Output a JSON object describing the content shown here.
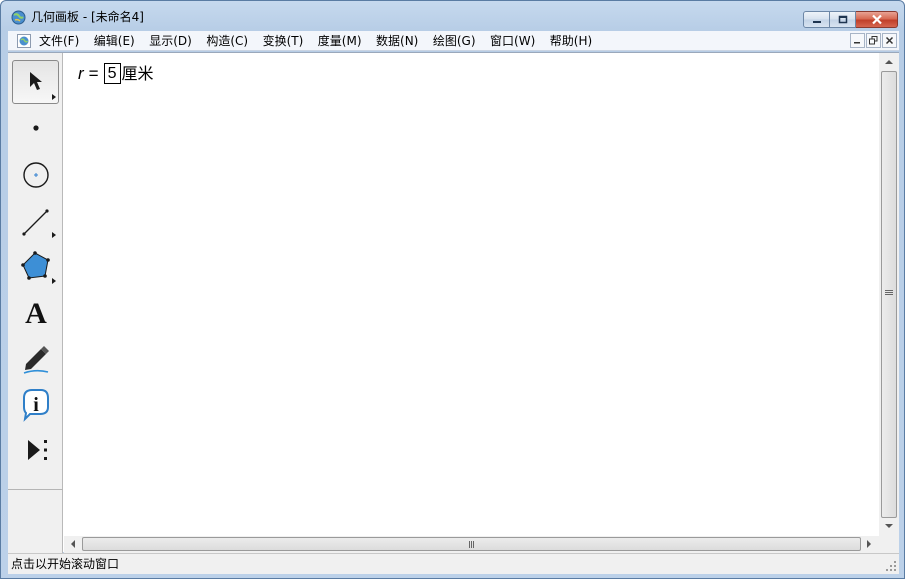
{
  "titlebar": {
    "title": "几何画板 - [未命名4]",
    "icons": [
      "app-globe-icon",
      "minimize-icon",
      "maximize-icon",
      "close-icon"
    ]
  },
  "menubar": {
    "items": [
      {
        "label": "文件(F)"
      },
      {
        "label": "编辑(E)"
      },
      {
        "label": "显示(D)"
      },
      {
        "label": "构造(C)"
      },
      {
        "label": "变换(T)"
      },
      {
        "label": "度量(M)"
      },
      {
        "label": "数据(N)"
      },
      {
        "label": "绘图(G)"
      },
      {
        "label": "窗口(W)"
      },
      {
        "label": "帮助(H)"
      }
    ]
  },
  "toolbox": {
    "tools": [
      {
        "icon": "selection-arrow-icon",
        "active": true
      },
      {
        "icon": "point-tool-icon"
      },
      {
        "icon": "compass-tool-icon"
      },
      {
        "icon": "straightedge-tool-icon"
      },
      {
        "icon": "polygon-tool-icon"
      },
      {
        "icon": "text-tool-icon",
        "glyph": "A"
      },
      {
        "icon": "marker-tool-icon"
      },
      {
        "icon": "information-tool-icon",
        "glyph": "i"
      },
      {
        "icon": "custom-tool-icon"
      }
    ]
  },
  "canvas": {
    "measurement": {
      "variable": "r",
      "equals": "=",
      "value": "5",
      "unit": "厘米"
    }
  },
  "statusbar": {
    "text": "点击以开始滚动窗口"
  },
  "colors": {
    "title_bg": "#bcd1e9",
    "close_button": "#c9432c",
    "polygon_fill": "#3d8fd6"
  }
}
